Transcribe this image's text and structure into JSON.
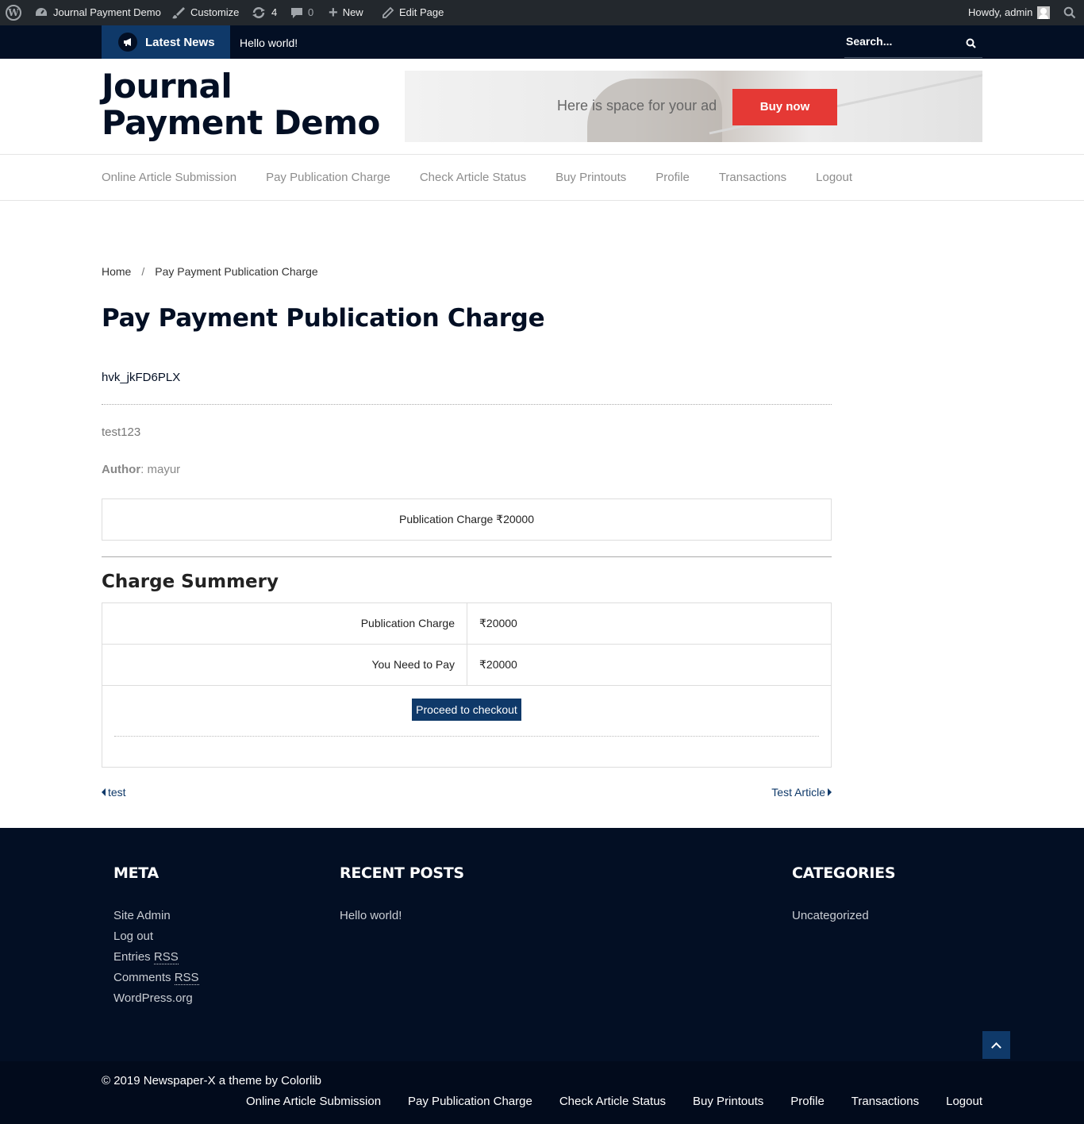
{
  "admin_bar": {
    "site_name": "Journal Payment Demo",
    "customize": "Customize",
    "updates_count": "4",
    "comments_count": "0",
    "new_label": "New",
    "edit_page": "Edit Page",
    "howdy": "Howdy, admin"
  },
  "news_bar": {
    "latest_label": "Latest News",
    "ticker_item": "Hello world!",
    "search_placeholder": "Search..."
  },
  "header": {
    "site_title": "Journal Payment Demo",
    "ad_text": "Here is space for your ad",
    "ad_button": "Buy now",
    "ad_button_color": "#e53935"
  },
  "main_nav": [
    "Online Article Submission",
    "Pay Publication Charge",
    "Check Article Status",
    "Buy Printouts",
    "Profile",
    "Transactions",
    "Logout"
  ],
  "breadcrumb": {
    "home": "Home",
    "separator": "/",
    "current": "Pay Payment Publication Charge"
  },
  "page": {
    "title": "Pay Payment Publication Charge",
    "token": "hvk_jkFD6PLX",
    "article_title": "test123",
    "author_label": "Author",
    "author_value": ": mayur",
    "charge_line": "Publication Charge ₹20000"
  },
  "summary": {
    "title": "Charge Summery",
    "rows": [
      {
        "label": "Publication Charge",
        "value": "₹20000"
      },
      {
        "label": "You Need to Pay",
        "value": "₹20000"
      }
    ],
    "checkout_button": "Proceed to checkout"
  },
  "post_nav": {
    "prev": "test",
    "next": "Test Article"
  },
  "footer": {
    "meta_title": "META",
    "meta_items": [
      "Site Admin",
      "Log out"
    ],
    "entries_prefix": "Entries ",
    "comments_prefix": "Comments ",
    "rss": "RSS",
    "wordpress_org": "WordPress.org",
    "recent_title": "RECENT POSTS",
    "recent_items": [
      "Hello world!"
    ],
    "categories_title": "CATEGORIES",
    "categories_items": [
      "Uncategorized"
    ],
    "copyright": "© 2019 Newspaper-X a theme by Colorlib",
    "bg_color": "#030f24"
  },
  "colors": {
    "navy": "#030f24",
    "accent_blue": "#0f3969",
    "admin_bar": "#23282d"
  }
}
